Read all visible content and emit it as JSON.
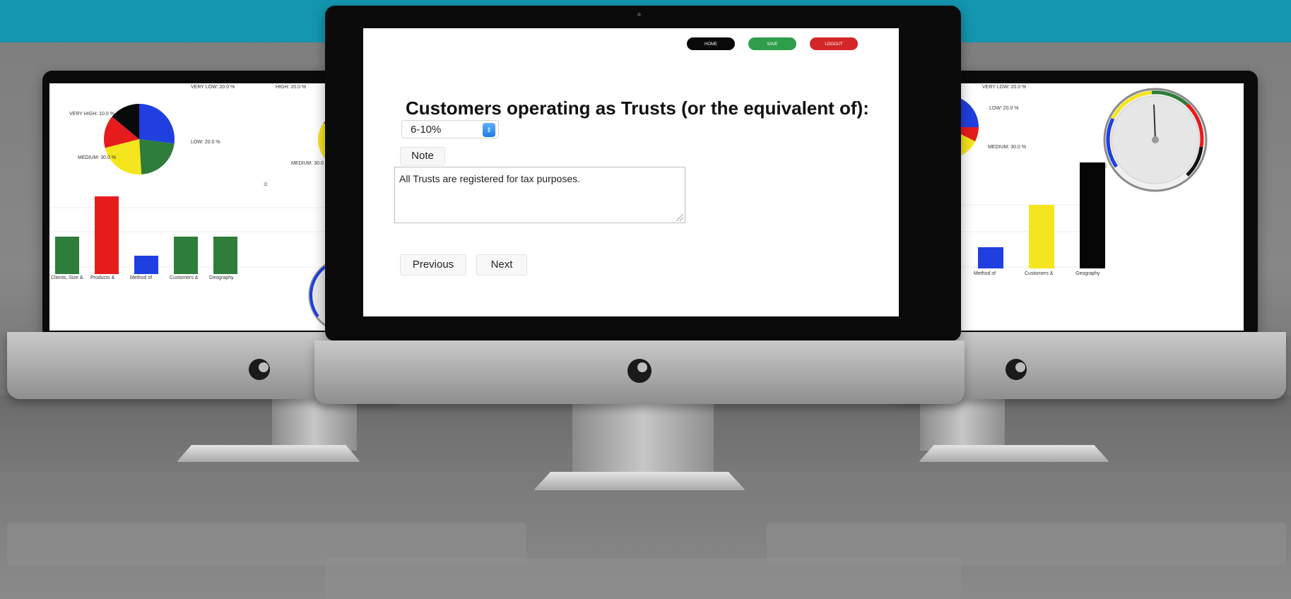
{
  "center": {
    "top_buttons": [
      {
        "label": "HOME",
        "color": "#0a0a0a"
      },
      {
        "label": "SAVE",
        "color": "#2f9e4a"
      },
      {
        "label": "LOGOUT",
        "color": "#d32626"
      }
    ],
    "question": "Customers operating as Trusts (or the equivalent of):",
    "select_value": "6-10%",
    "note_label": "Note",
    "note_text": "All Trusts are registered for tax purposes.",
    "prev_label": "Previous",
    "next_label": "Next"
  },
  "left": {
    "pie": {
      "slices": [
        {
          "color": "#1f3fe0",
          "fraction": 0.27
        },
        {
          "color": "#2e7d3a",
          "fraction": 0.22
        },
        {
          "color": "#f5e51e",
          "fraction": 0.22
        },
        {
          "color": "#e61c1c",
          "fraction": 0.15
        },
        {
          "color": "#0a0a0a",
          "fraction": 0.14
        }
      ],
      "labels": [
        "VERY LOW: 20.0 %",
        "LOW: 20.0 %",
        "MEDIUM: 30.0 %",
        "HIGH: 20.0 %",
        "VERY HIGH: 10.0 %",
        "MEDIUM: 30.0 %"
      ]
    },
    "bars": {
      "values": [
        0.45,
        0.93,
        0.22,
        0.45,
        0.45
      ],
      "colors": [
        "#2e7d3a",
        "#e61c1c",
        "#1f3fe0",
        "#2e7d3a",
        "#2e7d3a"
      ],
      "categories": [
        "Clients, Size &",
        "Products &",
        "Method of",
        "Customers &",
        "Geography"
      ]
    }
  },
  "right": {
    "pie_labels": [
      "VERY LOW: 20.0 %",
      "LOW: 20.0 %",
      "MEDIUM: 30.0 %"
    ],
    "bars": {
      "values": [
        0.2,
        0.6,
        1.0
      ],
      "colors": [
        "#1f3fe0",
        "#f5e51e",
        "#050505"
      ],
      "categories": [
        "Method of",
        "Customers &",
        "Geography"
      ]
    }
  }
}
